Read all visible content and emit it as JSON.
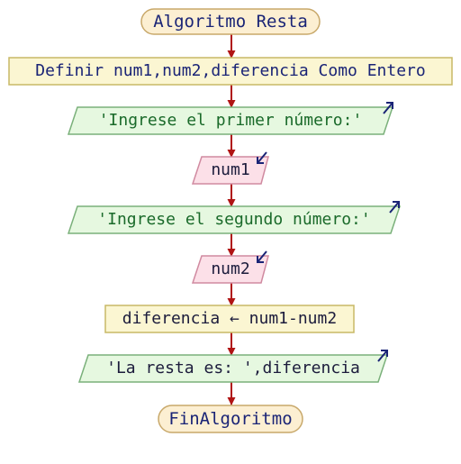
{
  "diagram": {
    "start_label": "Algoritmo Resta",
    "define_label": "Definir num1,num2,diferencia Como Entero",
    "output1_label": "'Ingrese el primer número:'",
    "input1_label": "num1",
    "output2_label": "'Ingrese el segundo número:'",
    "input2_label": "num2",
    "assign_label": "diferencia ← num1-num2",
    "output3_label": "'La resta es: ',diferencia",
    "end_label": "FinAlgoritmo"
  },
  "colors": {
    "terminal_fill": "#fcefd2",
    "terminal_stroke": "#c8a86a",
    "process_fill": "#fbf6d2",
    "process_stroke": "#c8b866",
    "output_fill": "#e6f8e0",
    "output_stroke": "#7ab07a",
    "input_fill": "#fce0e8",
    "input_stroke": "#d08aa0",
    "arrow": "#b01414",
    "io_marker": "#1a2476"
  }
}
